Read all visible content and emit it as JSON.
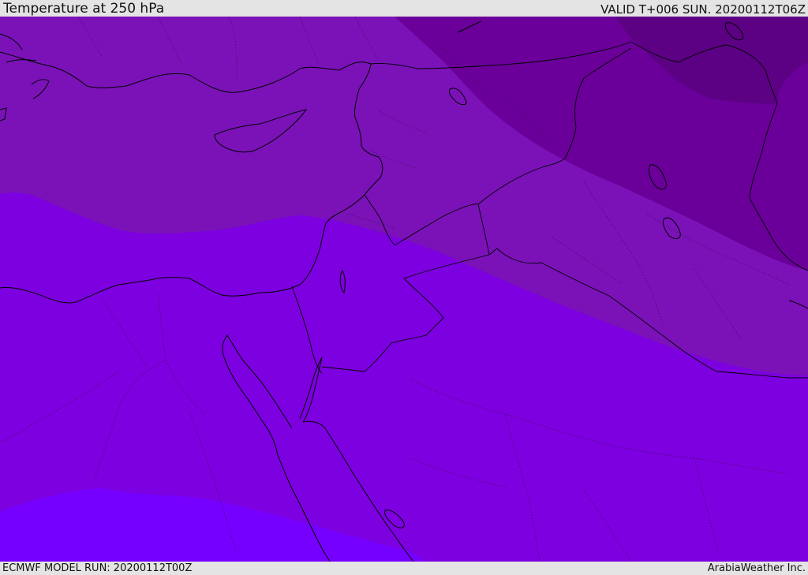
{
  "header": {
    "title": "Temperature at 250 hPa",
    "valid": "VALID T+006 SUN. 20200112T06Z"
  },
  "footer": {
    "model_run": "ECMWF MODEL RUN: 20200112T00Z",
    "credit": "ArabiaWeather Inc."
  },
  "colors": {
    "band_warmest": "#7600ff",
    "band_warm": "#7d00e0",
    "band_mid": "#7a12b8",
    "band_cool": "#6a0099",
    "band_coldest": "#5c0084"
  }
}
